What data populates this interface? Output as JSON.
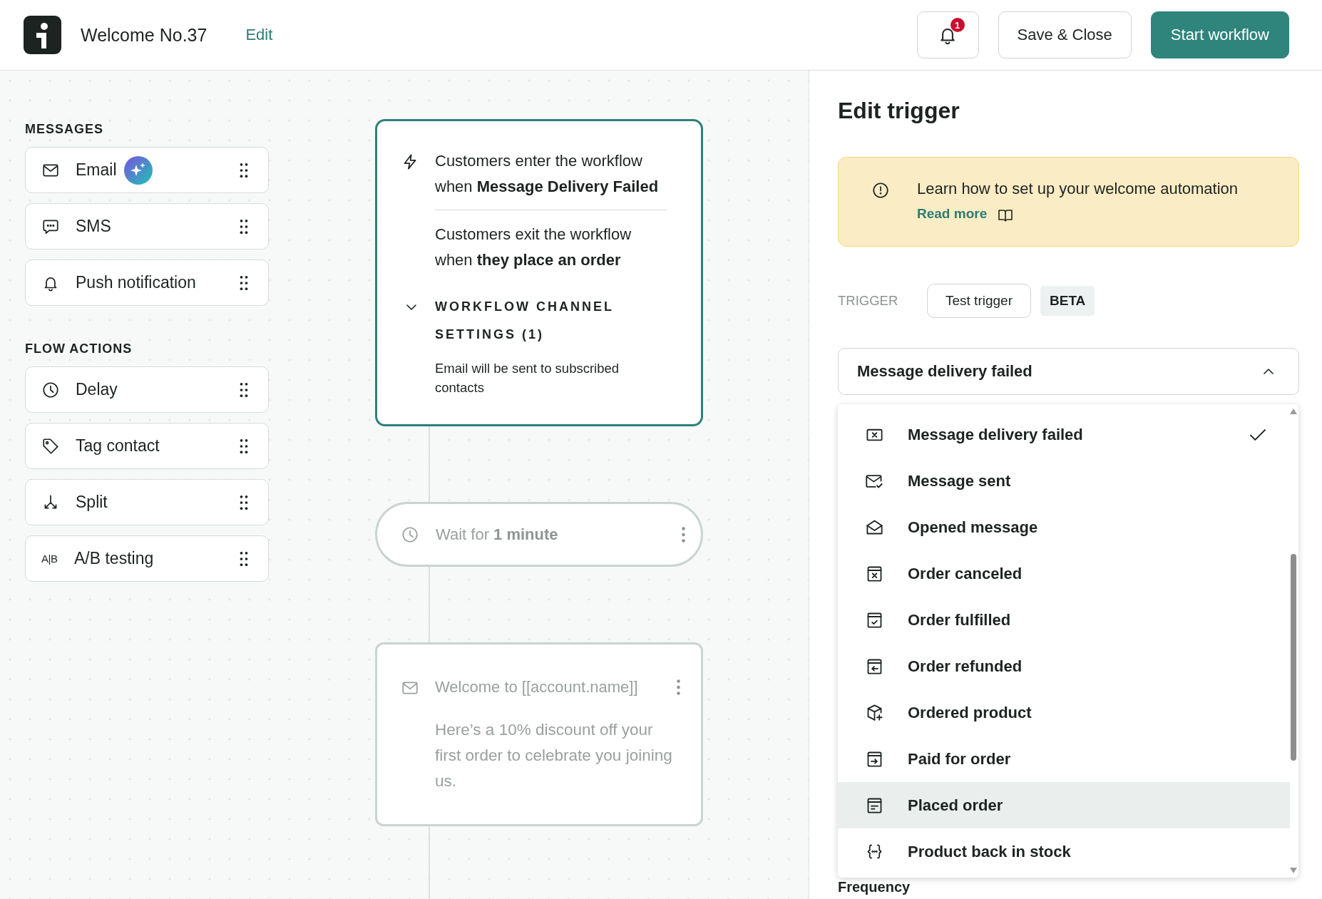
{
  "header": {
    "title": "Welcome No.37",
    "edit_link": "Edit",
    "notification_count": "1",
    "buttons": [
      {
        "label": "Save & Close",
        "kind": "secondary"
      },
      {
        "label": "Start workflow",
        "kind": "primary"
      }
    ]
  },
  "sidebar": {
    "sections": [
      {
        "title": "MESSAGES",
        "items": [
          {
            "label": "Email",
            "kind": "email",
            "ai_badge": true
          },
          {
            "label": "SMS",
            "kind": "sms",
            "ai_badge": false
          },
          {
            "label": "Push notification",
            "kind": "push",
            "ai_badge": false
          }
        ]
      },
      {
        "title": "FLOW ACTIONS",
        "items": [
          {
            "label": "Delay",
            "kind": "delay",
            "ai_badge": false
          },
          {
            "label": "Tag contact",
            "kind": "tag",
            "ai_badge": false
          },
          {
            "label": "Split",
            "kind": "split",
            "ai_badge": false
          },
          {
            "label": "A/B testing",
            "kind": "ab",
            "icon_text": "A|B",
            "ai_badge": false
          }
        ]
      }
    ]
  },
  "canvas": {
    "trigger_card": {
      "enter": "Customers enter the workflow when **Message Delivery Failed**",
      "exit": "Customers exit the workflow when **they place an order**",
      "channel_settings": {
        "title": "WORKFLOW CHANNEL SETTINGS (1)",
        "expanded": true,
        "description": "Email will be sent to subscribed contacts"
      }
    },
    "steps": [
      {
        "kind": "delay",
        "text": "Wait for **1 minute**"
      },
      {
        "kind": "email",
        "subject": "Welcome to [[account.name]]",
        "body": "Here’s a 10% discount off your first order to celebrate you joining us."
      }
    ]
  },
  "panel": {
    "title": "Edit trigger",
    "banner": {
      "text": "Learn how to set up your welcome automation",
      "link": "Read more"
    },
    "trigger_label": "TRIGGER",
    "test_button": "Test trigger",
    "badge": "BETA",
    "select": {
      "value": "Message delivery failed",
      "expanded": true
    },
    "options": [
      {
        "label": "Message delivery failed",
        "kind": "message_failed",
        "selected": true,
        "highlighted": false
      },
      {
        "label": "Message sent",
        "kind": "message_sent",
        "selected": false,
        "highlighted": false
      },
      {
        "label": "Opened message",
        "kind": "message_opened",
        "selected": false,
        "highlighted": false
      },
      {
        "label": "Order canceled",
        "kind": "order_canceled",
        "selected": false,
        "highlighted": false
      },
      {
        "label": "Order fulfilled",
        "kind": "order_fulfilled",
        "selected": false,
        "highlighted": false
      },
      {
        "label": "Order refunded",
        "kind": "order_refunded",
        "selected": false,
        "highlighted": false
      },
      {
        "label": "Ordered product",
        "kind": "product_ordered",
        "selected": false,
        "highlighted": false
      },
      {
        "label": "Paid for order",
        "kind": "order_paid",
        "selected": false,
        "highlighted": false
      },
      {
        "label": "Placed order",
        "kind": "order_placed",
        "selected": false,
        "highlighted": true
      },
      {
        "label": "Product back in stock",
        "kind": "back_in_stock",
        "selected": false,
        "highlighted": false
      }
    ],
    "frequency_label": "Frequency"
  }
}
